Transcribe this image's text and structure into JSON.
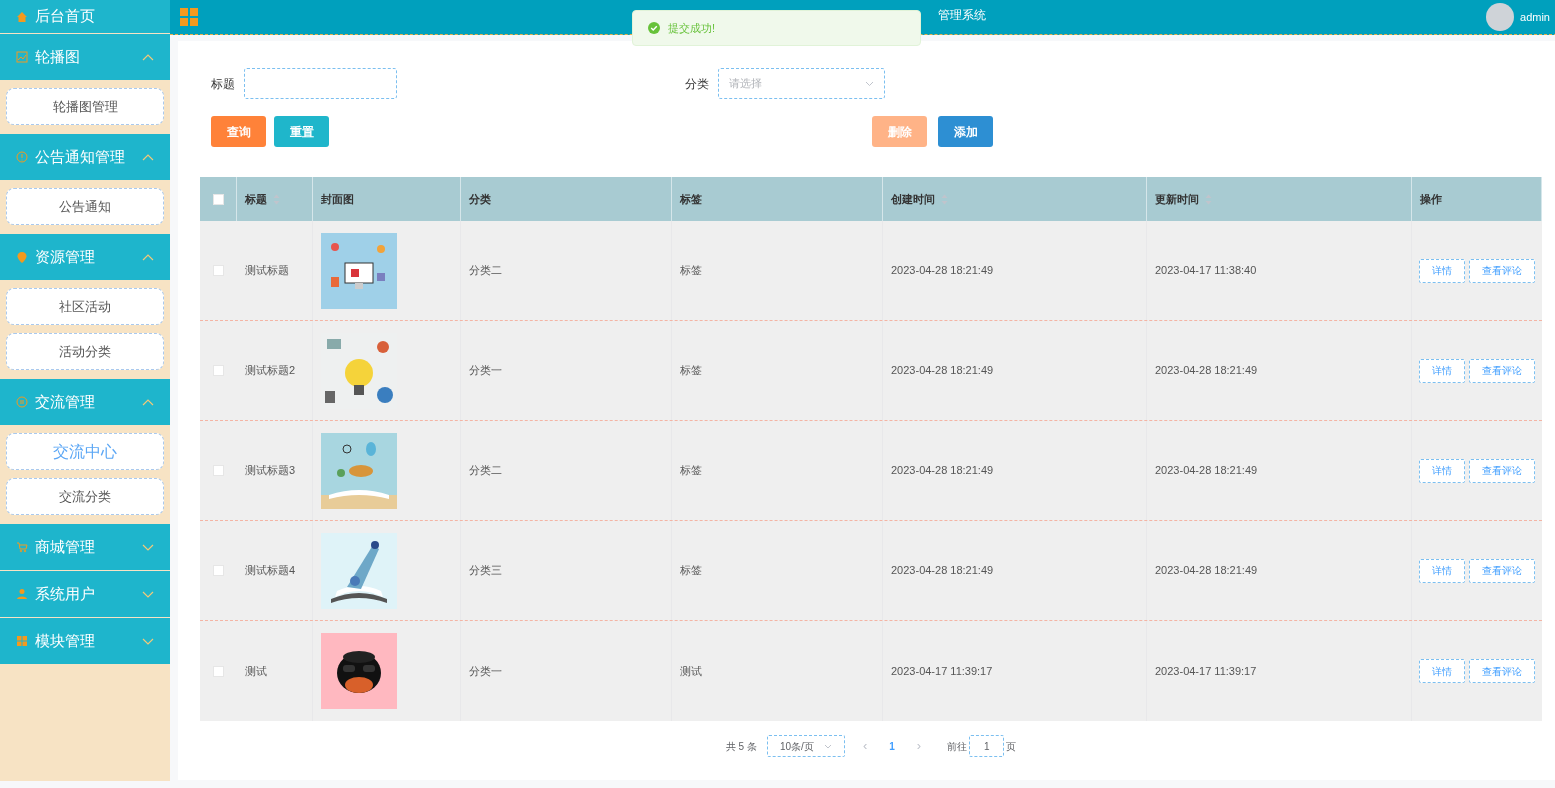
{
  "sidebar": {
    "items": [
      {
        "kind": "link",
        "label": "后台首页"
      },
      {
        "kind": "group",
        "label": "轮播图",
        "expanded": true,
        "children": [
          {
            "label": "轮播图管理",
            "selected": false
          }
        ]
      },
      {
        "kind": "group",
        "label": "公告通知管理",
        "expanded": true,
        "children": [
          {
            "label": "公告通知",
            "selected": false
          }
        ]
      },
      {
        "kind": "group",
        "label": "资源管理",
        "expanded": true,
        "children": [
          {
            "label": "社区活动",
            "selected": false
          },
          {
            "label": "活动分类",
            "selected": false
          }
        ]
      },
      {
        "kind": "group",
        "label": "交流管理",
        "expanded": true,
        "children": [
          {
            "label": "交流中心",
            "selected": true
          },
          {
            "label": "交流分类",
            "selected": false
          }
        ]
      },
      {
        "kind": "group",
        "label": "商城管理",
        "expanded": false
      },
      {
        "kind": "group",
        "label": "系统用户",
        "expanded": false
      },
      {
        "kind": "group",
        "label": "模块管理",
        "expanded": false
      }
    ]
  },
  "header": {
    "title": "管理系统",
    "user": "admin"
  },
  "toast": {
    "text": "提交成功!"
  },
  "filters": [
    {
      "label": "标题",
      "kind": "input"
    },
    {
      "label": "分类",
      "kind": "select",
      "placeholder": "请选择"
    }
  ],
  "buttons": [
    {
      "label": "查询",
      "kind": "search"
    },
    {
      "label": "重置",
      "kind": "reset"
    },
    {
      "label": "删除",
      "kind": "delete",
      "disabled": true
    },
    {
      "label": "添加",
      "kind": "add"
    }
  ],
  "table": {
    "columns": [
      {
        "label": "标题",
        "sortable": true
      },
      {
        "label": "封面图",
        "sortable": false
      },
      {
        "label": "分类",
        "sortable": false
      },
      {
        "label": "标签",
        "sortable": false
      },
      {
        "label": "创建时间",
        "sortable": true
      },
      {
        "label": "更新时间",
        "sortable": true
      },
      {
        "label": "操作",
        "sortable": false
      }
    ],
    "header_checked": false,
    "rows": [
      {
        "checked": false,
        "title": "测试标题",
        "category": "分类二",
        "tag": "标签",
        "created": "2023-04-28 18:21:49",
        "updated": "2023-04-17 11:38:40",
        "actions": [
          "详情",
          "查看评论"
        ]
      },
      {
        "checked": false,
        "title": "测试标题2",
        "category": "分类一",
        "tag": "标签",
        "created": "2023-04-28 18:21:49",
        "updated": "2023-04-28 18:21:49",
        "actions": [
          "详情",
          "查看评论"
        ]
      },
      {
        "checked": false,
        "title": "测试标题3",
        "category": "分类二",
        "tag": "标签",
        "created": "2023-04-28 18:21:49",
        "updated": "2023-04-28 18:21:49",
        "actions": [
          "详情",
          "查看评论"
        ]
      },
      {
        "checked": false,
        "title": "测试标题4",
        "category": "分类三",
        "tag": "标签",
        "created": "2023-04-28 18:21:49",
        "updated": "2023-04-28 18:21:49",
        "actions": [
          "详情",
          "查看评论"
        ]
      },
      {
        "checked": false,
        "title": "测试",
        "category": "分类一",
        "tag": "测试",
        "created": "2023-04-17 11:39:17",
        "updated": "2023-04-17 11:39:17",
        "actions": [
          "详情",
          "查看评论"
        ]
      }
    ]
  },
  "pagination": {
    "total": "共 5 条",
    "page_size": "10条/页",
    "prev": "‹",
    "pages": [
      {
        "label": "1",
        "selected": true
      }
    ],
    "next": "›",
    "goto_label": "前往",
    "goto_value": "1",
    "goto_suffix": "页"
  }
}
